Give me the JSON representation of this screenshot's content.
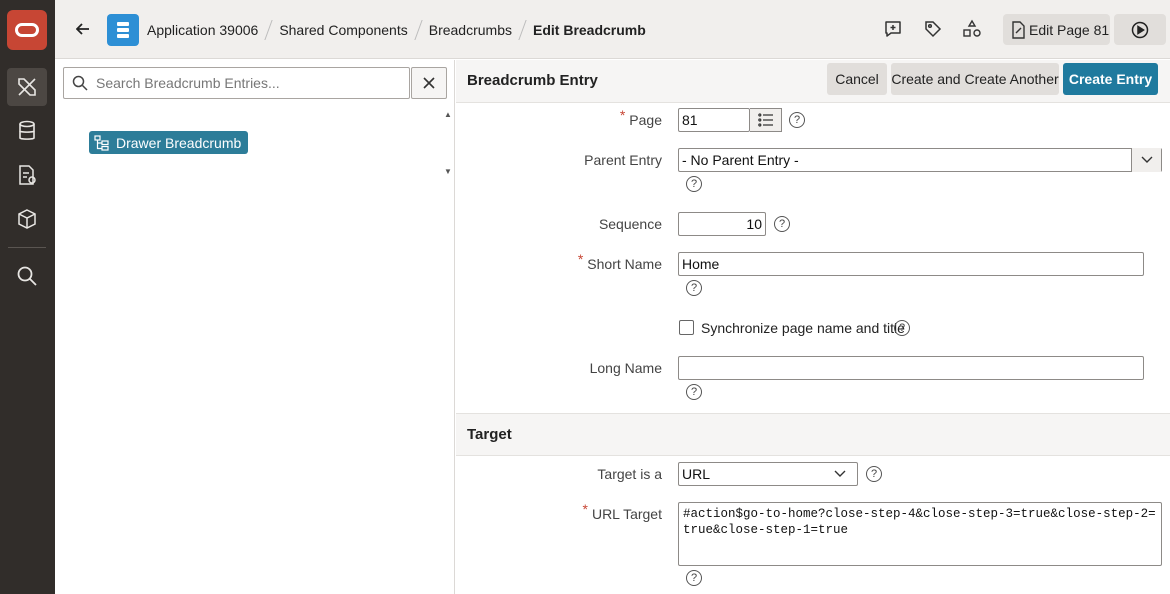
{
  "header": {
    "breadcrumbs": [
      "Application 39006",
      "Shared Components",
      "Breadcrumbs",
      "Edit Breadcrumb"
    ],
    "edit_page_label": "Edit Page 81"
  },
  "left": {
    "search_placeholder": "Search Breadcrumb Entries...",
    "tree_node_label": "Drawer Breadcrumb"
  },
  "region": {
    "title": "Breadcrumb Entry",
    "cancel_label": "Cancel",
    "create_another_label": "Create and Create Another",
    "create_label": "Create Entry"
  },
  "form": {
    "page_label": "Page",
    "page_value": "81",
    "parent_label": "Parent Entry",
    "parent_value": "- No Parent Entry -",
    "sequence_label": "Sequence",
    "sequence_value": "10",
    "short_name_label": "Short Name",
    "short_name_value": "Home",
    "sync_label": "Synchronize page name and title",
    "long_name_label": "Long Name",
    "long_name_value": ""
  },
  "target": {
    "title": "Target",
    "target_is_label": "Target is a",
    "target_is_value": "URL",
    "url_target_label": "URL Target",
    "url_target_value": "#action$go-to-home?close-step-4&close-step-3=true&close-step-2=true&close-step-1=true"
  },
  "help_glyph": "?",
  "required_marker": "*",
  "colors": {
    "rail": "#312d2a",
    "logo": "#c74634",
    "app_icon": "#2d8fd5",
    "primary_button": "#1f7a9e",
    "tree_node": "#2d7d99"
  }
}
